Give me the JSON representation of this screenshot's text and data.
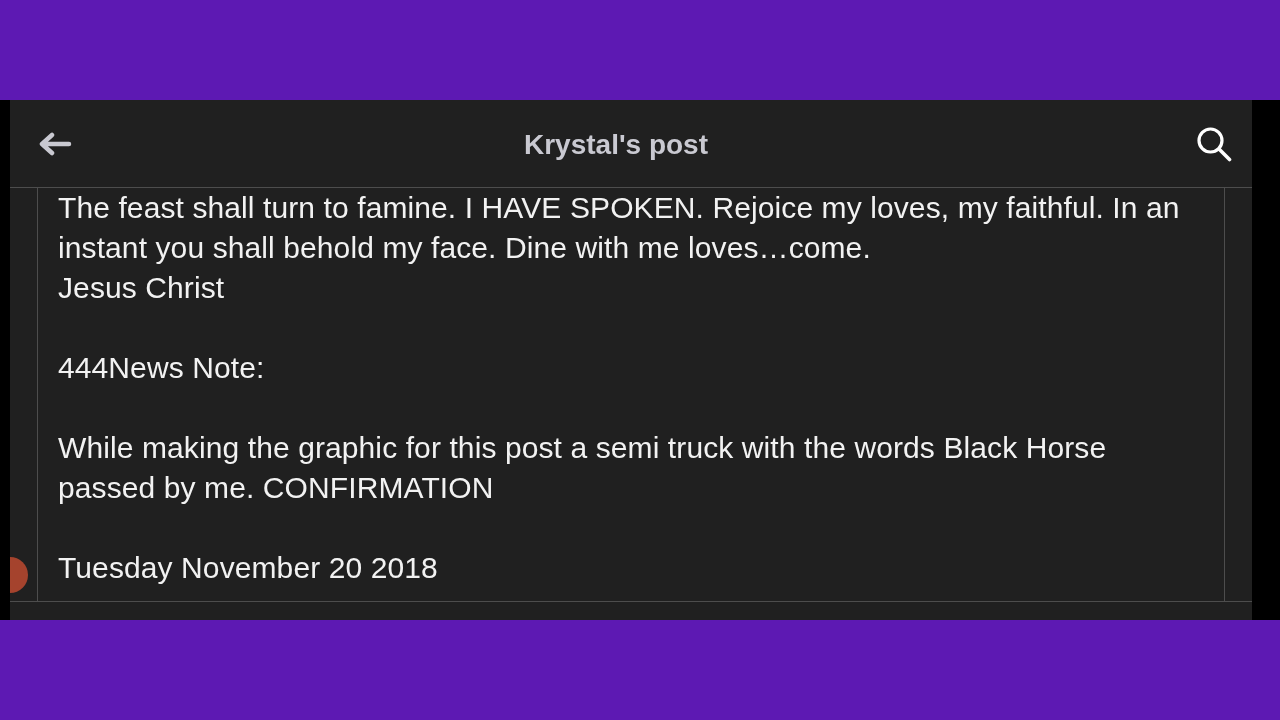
{
  "header": {
    "title": "Krystal's post"
  },
  "post": {
    "sections": [
      {
        "lines": [
          "The feast shall turn to famine. I HAVE SPOKEN. Rejoice my loves, my faithful. In an instant you shall behold my face. Dine with me loves…come.",
          "Jesus Christ"
        ]
      },
      {
        "lines": [
          "444News Note:"
        ]
      },
      {
        "lines": [
          "While making the graphic for this post a semi truck with the words Black Horse passed by me. CONFIRMATION"
        ]
      },
      {
        "lines": [
          "Tuesday November 20 2018"
        ]
      }
    ]
  }
}
